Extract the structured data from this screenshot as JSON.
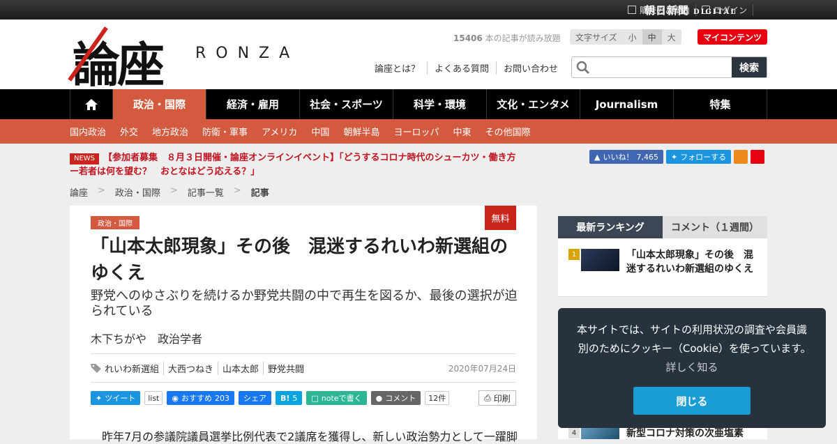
{
  "topbar": {
    "subscribe_label": "購読のご案内",
    "login_label": "ログイン",
    "asahi_logo": "朝日新聞",
    "asahi_digital": "DIGITAL"
  },
  "header": {
    "logo_kanji": "論座",
    "logo_roman": "RONZA",
    "read_free_count": "15406",
    "read_free_text": " 本の記事が読み放題",
    "font_size_label": "文字サイズ",
    "font_sizes": [
      "小",
      "中",
      "大"
    ],
    "font_size_selected": "中",
    "my_content_label": "マイコンテンツ",
    "links": [
      "論座とは？",
      "よくある質問",
      "お問い合わせ"
    ],
    "search_placeholder": "",
    "search_button": "検索"
  },
  "nav": {
    "items": [
      "政治・国際",
      "経済・雇用",
      "社会・スポーツ",
      "科学・環境",
      "文化・エンタメ",
      "Journalism",
      "特集"
    ],
    "active": "政治・国際"
  },
  "subnav": {
    "items": [
      "国内政治",
      "外交",
      "地方政治",
      "防衛・軍事",
      "アメリカ",
      "中国",
      "朝鮮半島",
      "ヨーロッパ",
      "中東",
      "その他国際"
    ]
  },
  "news": {
    "tag": "NEWS",
    "text": "【参加者募集　８月３日開催・論座オンラインイベント】「どうするコロナ時代のシューカツ・働き方ー若者は何を望む？　おとなはどう応える？」"
  },
  "social": {
    "fb_label": "いいね！",
    "fb_count": "7,465",
    "tw_label": "フォローする"
  },
  "breadcrumb": [
    "論座",
    "政治・国際",
    "記事一覧",
    "記事"
  ],
  "article": {
    "free_badge": "無料",
    "category": "政治・国際",
    "title": "「山本太郎現象」その後　混迷するれいわ新選組のゆくえ",
    "subtitle": "野党へのゆさぶりを続けるか野党共闘の中で再生を図るか、最後の選択が迫られている",
    "author": "木下ちがや　政治学者",
    "tags": [
      "れいわ新選組",
      "大西つねき",
      "山本太郎",
      "野党共闘"
    ],
    "date": "2020年07月24日",
    "share": {
      "tweet": "ツイート",
      "list": "list",
      "fb_recommend": "おすすめ",
      "fb_count": "203",
      "fb_share": "シェア",
      "hatena_label": "B!",
      "hatena_count": "5",
      "note": "noteで書く",
      "comment": "コメント",
      "comment_count": "12件",
      "print": "印刷"
    },
    "body_start": "昨年7月の参議院議員選挙比例代表で2議席を獲得し、新しい政治勢力として一躍脚"
  },
  "sidebar": {
    "tab_ranking": "最新ランキング",
    "tab_comment": "コメント（１週間）",
    "rank1_num": "1",
    "rank1_title": "「山本太郎現象」その後　混迷するれいわ新選組のゆくえ",
    "rank4_num": "4",
    "rank4_title": "新型コロナ対策の次亜塩素"
  },
  "cookie": {
    "message": "本サイトでは、サイトの利用状況の調査や会員識別のためにクッキー（Cookie）を使っています。",
    "more": "詳しく知る",
    "close": "閉じる"
  },
  "colors": {
    "accent": "#d35a3e",
    "my_content": "#e60012",
    "cookie_bg": "#27323f",
    "cookie_btn": "#1a9cd4"
  }
}
